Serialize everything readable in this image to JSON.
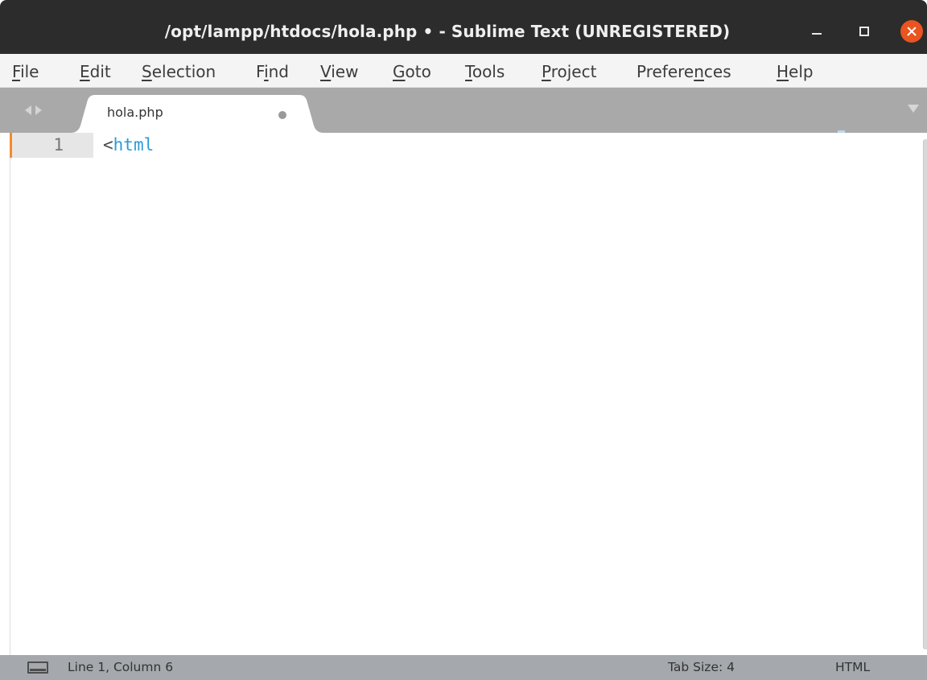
{
  "window": {
    "title": "/opt/lampp/htdocs/hola.php • - Sublime Text (UNREGISTERED)"
  },
  "menu": [
    {
      "pre": "",
      "mn": "F",
      "post": "ile"
    },
    {
      "pre": "",
      "mn": "E",
      "post": "dit"
    },
    {
      "pre": "",
      "mn": "S",
      "post": "election"
    },
    {
      "pre": "F",
      "mn": "i",
      "post": "nd"
    },
    {
      "pre": "",
      "mn": "V",
      "post": "iew"
    },
    {
      "pre": "",
      "mn": "G",
      "post": "oto"
    },
    {
      "pre": "",
      "mn": "T",
      "post": "ools"
    },
    {
      "pre": "",
      "mn": "P",
      "post": "roject"
    },
    {
      "pre": "Prefere",
      "mn": "n",
      "post": "ces"
    },
    {
      "pre": "",
      "mn": "H",
      "post": "elp"
    }
  ],
  "tab": {
    "label": "hola.php",
    "dirty": true
  },
  "editor": {
    "line_number": "1",
    "code_punct": "<",
    "code_tag": "html"
  },
  "status": {
    "position": "Line 1, Column 6",
    "tab_size": "Tab Size: 4",
    "syntax": "HTML"
  },
  "colors": {
    "titlebar": "#2c2c2c",
    "close_button": "#e95420",
    "tag": "#2b9ad9",
    "modified_marker": "#f38b29",
    "statusbar": "#a5a8ac"
  },
  "icons": {
    "close": "close-icon",
    "minimize": "minimize-icon",
    "maximize": "maximize-icon",
    "panel": "panel-toggle-icon"
  }
}
